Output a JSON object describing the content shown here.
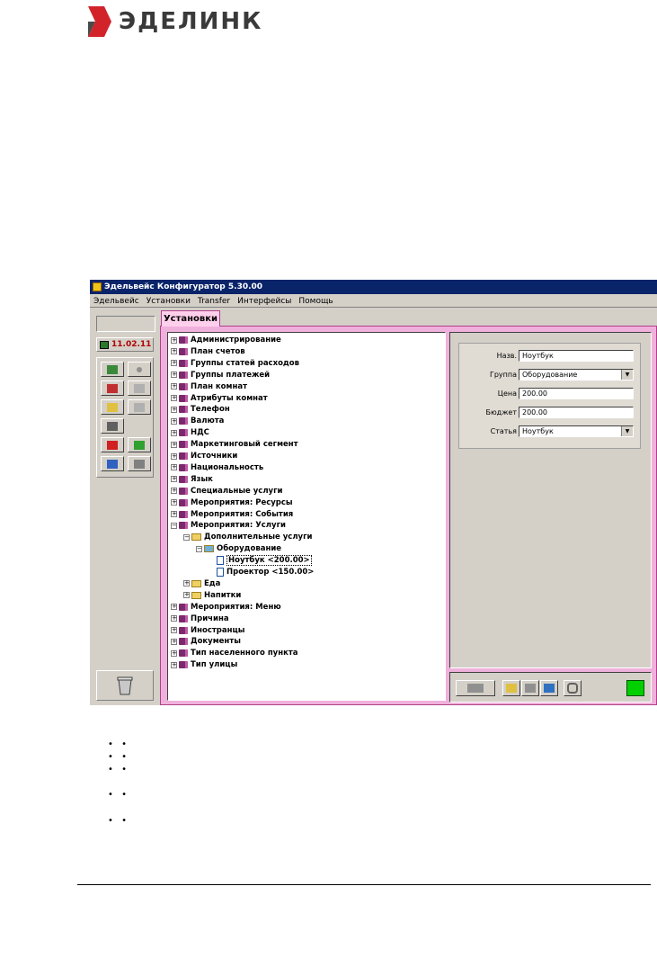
{
  "logo": {
    "text": "ЭДЕЛИНК",
    "colors": {
      "mark_red": "#d2232a",
      "mark_gray": "#4a4a4a"
    }
  },
  "window": {
    "title": "Эдельвейс Конфигуратор 5.30.00",
    "menu": [
      "Эдельвейс",
      "Установки",
      "Transfer",
      "Интерфейсы",
      "Помощь"
    ],
    "date": "11.02.11",
    "tab": "Установки",
    "tree": [
      {
        "label": "Администрирование",
        "expander": "+",
        "icon": "book-icon",
        "level": 0
      },
      {
        "label": "План счетов",
        "expander": "+",
        "icon": "book-icon",
        "level": 0
      },
      {
        "label": "Группы статей расходов",
        "expander": "+",
        "icon": "book-icon",
        "level": 0
      },
      {
        "label": "Группы платежей",
        "expander": "+",
        "icon": "book-icon",
        "level": 0
      },
      {
        "label": "План комнат",
        "expander": "+",
        "icon": "book-icon",
        "level": 0
      },
      {
        "label": "Атрибуты комнат",
        "expander": "+",
        "icon": "book-icon",
        "level": 0
      },
      {
        "label": "Телефон",
        "expander": "+",
        "icon": "book-icon",
        "level": 0
      },
      {
        "label": "Валюта",
        "expander": "+",
        "icon": "book-icon",
        "level": 0
      },
      {
        "label": "НДС",
        "expander": "+",
        "icon": "book-icon",
        "level": 0
      },
      {
        "label": "Маркетинговый сегмент",
        "expander": "+",
        "icon": "book-icon",
        "level": 0
      },
      {
        "label": "Источники",
        "expander": "+",
        "icon": "book-icon",
        "level": 0
      },
      {
        "label": "Национальность",
        "expander": "+",
        "icon": "book-icon",
        "level": 0
      },
      {
        "label": "Язык",
        "expander": "+",
        "icon": "book-icon",
        "level": 0
      },
      {
        "label": "Специальные услуги",
        "expander": "+",
        "icon": "book-icon",
        "level": 0
      },
      {
        "label": "Мероприятия: Ресурсы",
        "expander": "+",
        "icon": "book-icon",
        "level": 0
      },
      {
        "label": "Мероприятия: События",
        "expander": "+",
        "icon": "book-icon",
        "level": 0
      },
      {
        "label": "Мероприятия: Услуги",
        "expander": "−",
        "icon": "book-icon",
        "level": 0
      },
      {
        "label": "Дополнительные услуги",
        "expander": "−",
        "icon": "folder-icon",
        "level": 1
      },
      {
        "label": "Оборудование",
        "expander": "−",
        "icon": "folder-open-icon",
        "level": 2
      },
      {
        "label": "Ноутбук <200.00>",
        "expander": "",
        "icon": "document-icon",
        "level": 3,
        "selected": true
      },
      {
        "label": "Проектор <150.00>",
        "expander": "",
        "icon": "document-icon",
        "level": 3
      },
      {
        "label": "Еда",
        "expander": "+",
        "icon": "folder-icon",
        "level": 1
      },
      {
        "label": "Напитки",
        "expander": "+",
        "icon": "folder-icon",
        "level": 1
      },
      {
        "label": "Мероприятия: Меню",
        "expander": "+",
        "icon": "book-icon",
        "level": 0
      },
      {
        "label": "Причина",
        "expander": "+",
        "icon": "book-icon",
        "level": 0
      },
      {
        "label": "Иностранцы",
        "expander": "+",
        "icon": "book-icon",
        "level": 0
      },
      {
        "label": "Документы",
        "expander": "+",
        "icon": "book-icon",
        "level": 0
      },
      {
        "label": "Тип населенного пункта",
        "expander": "+",
        "icon": "book-icon",
        "level": 0
      },
      {
        "label": "Тип улицы",
        "expander": "+",
        "icon": "book-icon",
        "level": 0
      }
    ],
    "form": {
      "name_label": "Назв.",
      "name_value": "Ноутбук",
      "group_label": "Группа",
      "group_value": "Оборудование",
      "price_label": "Цена",
      "price_value": "200.00",
      "budget_label": "Бюджет",
      "budget_value": "200.00",
      "article_label": "Статья",
      "article_value": "Ноутбук"
    },
    "status_color": "#00d000"
  },
  "bullets": [
    "• •",
    "• •",
    "• •",
    "• •",
    "• •"
  ]
}
